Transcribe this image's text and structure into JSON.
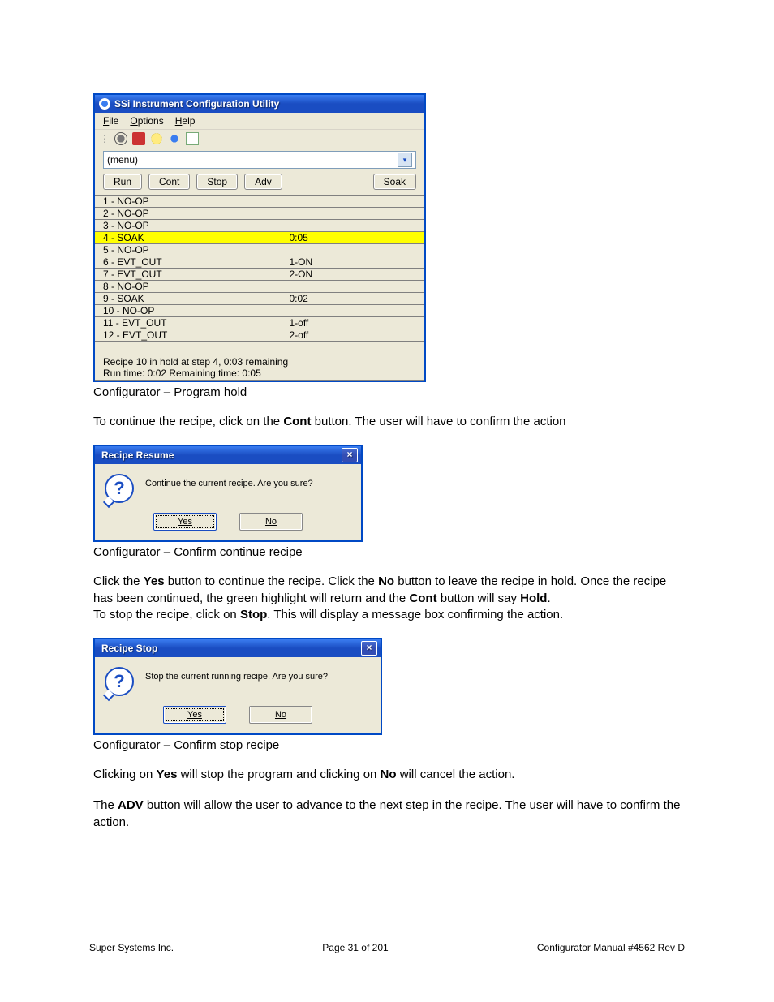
{
  "mainWindow": {
    "title": "SSi Instrument Configuration Utility",
    "menus": [
      "File",
      "Options",
      "Help"
    ],
    "dropdown": "(menu)",
    "buttons": {
      "run": "Run",
      "cont": "Cont",
      "stop": "Stop",
      "adv": "Adv",
      "soak": "Soak"
    },
    "steps": [
      {
        "label": "1 - NO-OP",
        "val": ""
      },
      {
        "label": "2 - NO-OP",
        "val": ""
      },
      {
        "label": "3 - NO-OP",
        "val": ""
      },
      {
        "label": "4 - SOAK",
        "val": "0:05",
        "hl": true
      },
      {
        "label": "5 - NO-OP",
        "val": ""
      },
      {
        "label": "6 - EVT_OUT",
        "val": "1-ON"
      },
      {
        "label": "7 - EVT_OUT",
        "val": "2-ON"
      },
      {
        "label": "8 - NO-OP",
        "val": ""
      },
      {
        "label": "9 - SOAK",
        "val": "0:02"
      },
      {
        "label": "10 - NO-OP",
        "val": ""
      },
      {
        "label": "11 - EVT_OUT",
        "val": "1-off"
      },
      {
        "label": "12 - EVT_OUT",
        "val": "2-off"
      }
    ],
    "status1": "Recipe 10 in hold at step 4, 0:03 remaining",
    "status2": "Run time: 0:02 Remaining time: 0:05"
  },
  "captions": {
    "c1": "Configurator – Program hold",
    "c2": "Configurator – Confirm continue recipe",
    "c3": "Configurator – Confirm stop recipe"
  },
  "paras": {
    "p1a": "To continue the recipe, click on the ",
    "p1b": "Cont",
    "p1c": " button.  The user will have to confirm the action",
    "p2a": "Click the ",
    "p2b": "Yes",
    "p2c": " button to continue the recipe.  Click the ",
    "p2d": "No",
    "p2e": " button to leave the recipe in hold.  Once the recipe has been continued, the green highlight will return and the ",
    "p2f": "Cont",
    "p2g": " button will say ",
    "p2h": "Hold",
    "p2i": ".",
    "p3a": "To stop the recipe, click on ",
    "p3b": "Stop",
    "p3c": ".  This will display a message box confirming the action.",
    "p4a": "Clicking on ",
    "p4b": "Yes",
    "p4c": " will stop the program and clicking on ",
    "p4d": "No",
    "p4e": " will cancel the action.",
    "p5a": "The ",
    "p5b": "ADV",
    "p5c": " button will allow the user to advance to the next step in the recipe.  The user will have to confirm the action."
  },
  "dialogResume": {
    "title": "Recipe Resume",
    "text": "Continue the current recipe.  Are you sure?",
    "yes": "Yes",
    "no": "No"
  },
  "dialogStop": {
    "title": "Recipe Stop",
    "text": "Stop the current running recipe.  Are you sure?",
    "yes": "Yes",
    "no": "No"
  },
  "footer": {
    "left": "Super Systems Inc.",
    "center": "Page 31 of 201",
    "right": "Configurator Manual #4562 Rev D"
  }
}
